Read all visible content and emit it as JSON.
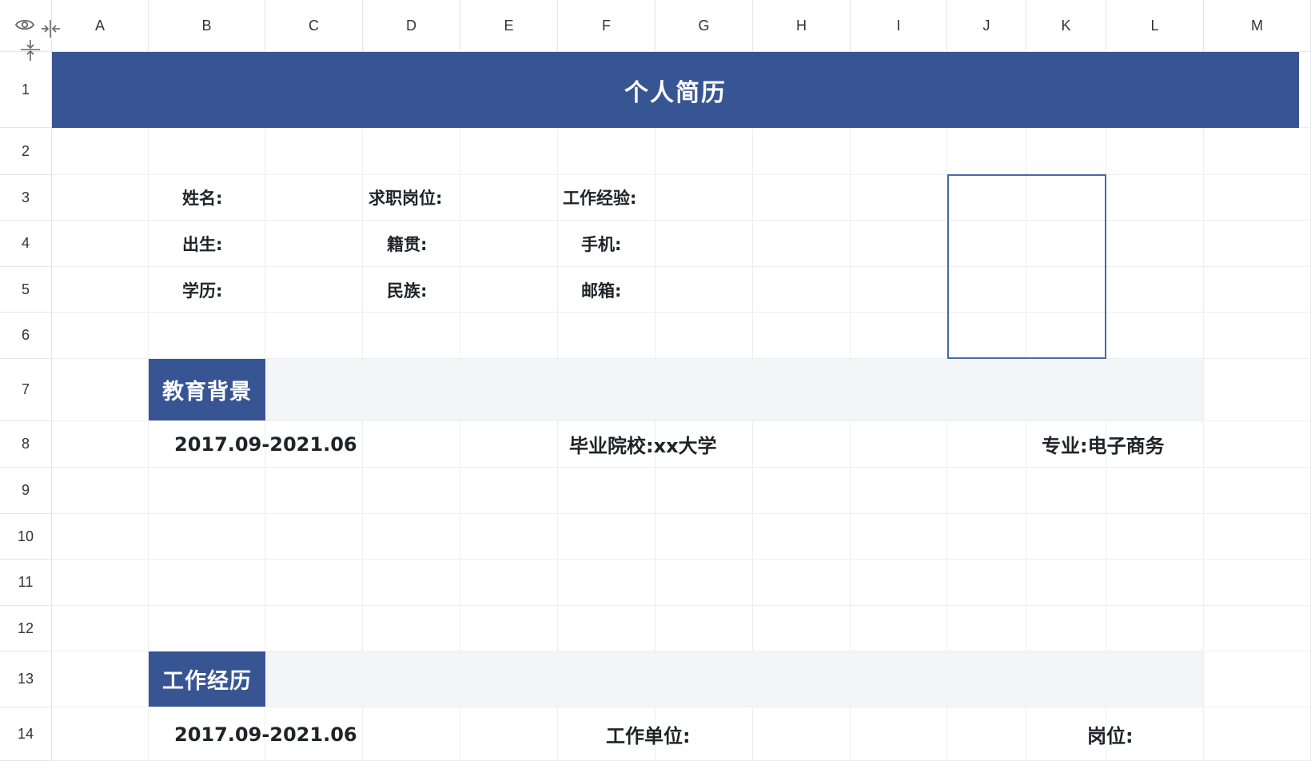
{
  "columns": [
    "A",
    "B",
    "C",
    "D",
    "E",
    "F",
    "G",
    "H",
    "I",
    "J",
    "K",
    "L",
    "M"
  ],
  "rows": [
    "1",
    "2",
    "3",
    "4",
    "5",
    "6",
    "7",
    "8",
    "9",
    "10",
    "11",
    "12",
    "13",
    "14"
  ],
  "icons": {
    "view": "eye-icon",
    "col_freeze": "freeze-columns-icon",
    "row_freeze": "freeze-rows-icon"
  },
  "colors": {
    "accent": "#385593",
    "band": "#f4f5f7",
    "grid": "#eceef1",
    "photo_border": "#4a6aa5"
  },
  "resume": {
    "title": "个人简历",
    "info": {
      "name_label": "姓名:",
      "job_label": "求职岗位:",
      "experience_label": "工作经验:",
      "birth_label": "出生:",
      "origin_label": "籍贯:",
      "phone_label": "手机:",
      "education_label": "学历:",
      "ethnicity_label": "民族:",
      "email_label": "邮箱:"
    },
    "education": {
      "heading": "教育背景",
      "period": "2017.09-2021.06",
      "school": "毕业院校:xx大学",
      "major": "专业:电子商务"
    },
    "work": {
      "heading": "工作经历",
      "period": "2017.09-2021.06",
      "company": "工作单位:",
      "position": "岗位:"
    }
  }
}
